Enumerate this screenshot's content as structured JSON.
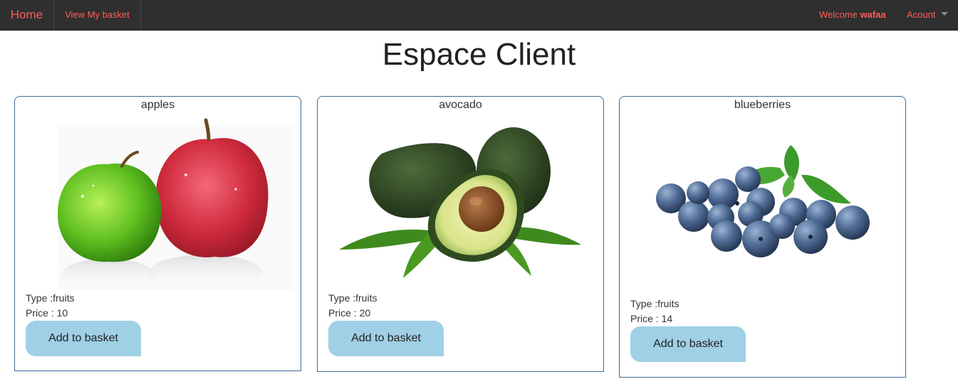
{
  "nav": {
    "brand": "Home",
    "basket_link": "View My basket",
    "welcome_prefix": "Welcome ",
    "username": "wafaa",
    "account": "Acount"
  },
  "page": {
    "title": "Espace Client"
  },
  "products": [
    {
      "name": "apples",
      "type_label": "Type :fruits",
      "price_label": "Price : 10",
      "button": "Add to basket",
      "image_icon": "apples-image"
    },
    {
      "name": "avocado",
      "type_label": "Type :fruits",
      "price_label": "Price : 20",
      "button": "Add to basket",
      "image_icon": "avocado-image"
    },
    {
      "name": "blueberries",
      "type_label": "Type :fruits",
      "price_label": "Price : 14",
      "button": "Add to basket",
      "image_icon": "blueberries-image"
    }
  ],
  "colors": {
    "navbar_bg": "#2f2f2f",
    "nav_text": "#ff5c5c",
    "card_border": "#3b6c99",
    "button_bg": "#9fd0e6"
  }
}
